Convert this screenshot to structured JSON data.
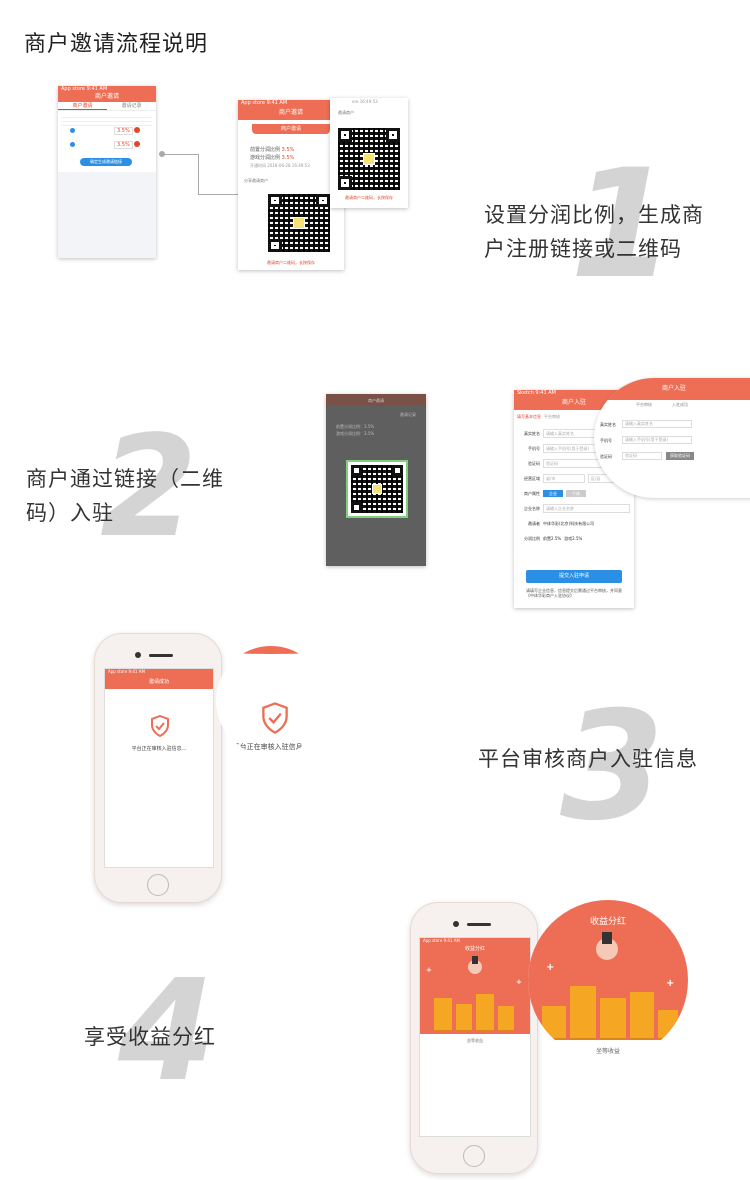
{
  "page": {
    "title": "商户邀请流程说明"
  },
  "steps": [
    {
      "number": "1",
      "text_line1": "设置分润比例，生成商",
      "text_line2": "户注册链接或二维码"
    },
    {
      "number": "2",
      "text_line1": "商户通过链接（二维",
      "text_line2": "码）入驻"
    },
    {
      "number": "3",
      "text": "平台审核商户入驻信息"
    },
    {
      "number": "4",
      "text": "享受收益分红"
    }
  ],
  "step1_screens": {
    "left": {
      "status": "App store  9:41 AM",
      "nav_title": "商户邀请",
      "tab_active": "商户邀请",
      "tab_other": "邀请记录",
      "rate1": "3.5%",
      "rate2": "3.5%",
      "button": "确定生成邀请链接"
    },
    "middle": {
      "status": "App store  9:41 AM",
      "nav_title": "商户邀请",
      "card_title": "商户邀请",
      "line1_label": "前置分润比例",
      "line1_value": "3.5%",
      "line2_label": "游戏分润比例",
      "line2_value": "3.5%",
      "time": "开通时间 2018-06-28 16:49:53",
      "share_label": "分享邀请商户",
      "qr_caption": "邀请商户二维码，长按保存"
    },
    "right": {
      "top": "ore 16:49:53",
      "head": "邀请商户",
      "qr_caption": "邀请商户二维码，长按保存"
    }
  },
  "step2_screens": {
    "scan": {
      "nav_title": "商户邀请",
      "tab_other": "邀请记录",
      "line1": "前置分润比例：3.5%",
      "line2": "游戏分润比例：3.5%"
    },
    "form": {
      "status": "Sketch  9:41 AM",
      "nav_title": "商户入驻",
      "circle_title": "商户入驻",
      "step1": "填写基本信息",
      "step2": "平台审核",
      "step3": "入驻成功",
      "fields": [
        {
          "label": "真实姓名",
          "placeholder": "请输入真实姓名"
        },
        {
          "label": "手机号",
          "placeholder": "请输入手机号(用于登录)"
        },
        {
          "label": "验证码",
          "placeholder": "验证码",
          "action": "获取验证码"
        },
        {
          "label": "经营区域",
          "placeholder": "省/市",
          "placeholder2": "区/县"
        },
        {
          "label": "商户属性",
          "option1": "企业",
          "option2": "个体"
        },
        {
          "label": "企业名称",
          "placeholder": "请输入企业名称"
        },
        {
          "label": "邀请者",
          "value": "中体华彩(北京)科技有限公司"
        },
        {
          "label": "分润比例",
          "value": "前置2.5%",
          "value2": "游戏2.5%"
        }
      ],
      "submit": "提交入驻申请",
      "agreement": "请填写企业信息，信息提交后需通过平台审核，并同意《中体华彩商户入驻协议》"
    }
  },
  "step3_screens": {
    "status": "App store  9:41 AM",
    "nav_title": "邀请成功",
    "message": "平台正在审核入驻信息...",
    "zoom_message": "平台正在审核入驻信息..."
  },
  "step4_screens": {
    "status": "App store  9:41 AM",
    "nav_title": "收益分红",
    "bottom_text": "坐等收益",
    "zoom_title": "收益分红",
    "zoom_bottom": "坐等收益"
  },
  "colors": {
    "brand": "#ee6e55",
    "accent_blue": "#2b8fe5",
    "number_gray": "#d4d4d4"
  }
}
